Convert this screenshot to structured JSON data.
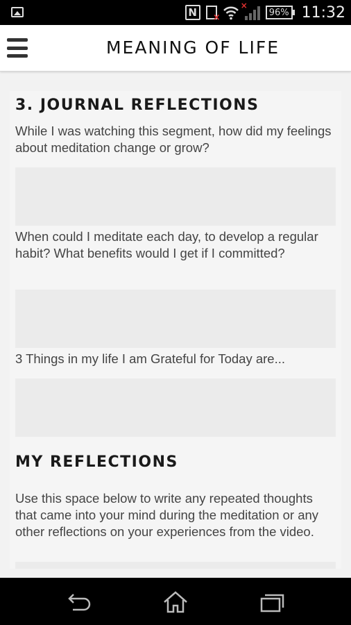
{
  "status_bar": {
    "nfc_glyph": "N",
    "battery": "96%",
    "time": "11:32"
  },
  "app_bar": {
    "title": "MEANING OF LIFE",
    "menu_icon": "hamburger-menu-icon"
  },
  "journal": {
    "heading": "3. JOURNAL REFLECTIONS",
    "questions": [
      "While I was watching this segment, how did my feelings about meditation change or grow?",
      "When could I meditate each day, to develop a regular habit? What benefits would I get if I committed?",
      "3 Things in my life I am Grateful for Today are..."
    ],
    "answers": [
      "",
      "",
      ""
    ]
  },
  "my_reflections": {
    "heading": "MY REFLECTIONS",
    "description": "Use this space below to write any repeated thoughts that came into your mind during the meditation or any other reflections on your experiences from the video.",
    "answer": ""
  },
  "nav_bar": {
    "icons": [
      "back-icon",
      "home-icon",
      "recents-icon"
    ]
  },
  "colors": {
    "status_bar_bg": "#000000",
    "app_bar_bg": "#ffffff",
    "content_bg": "#f5f5f5",
    "answer_box_bg": "#ebebeb",
    "heading_text": "#1a1a1a",
    "body_text": "#444444"
  }
}
